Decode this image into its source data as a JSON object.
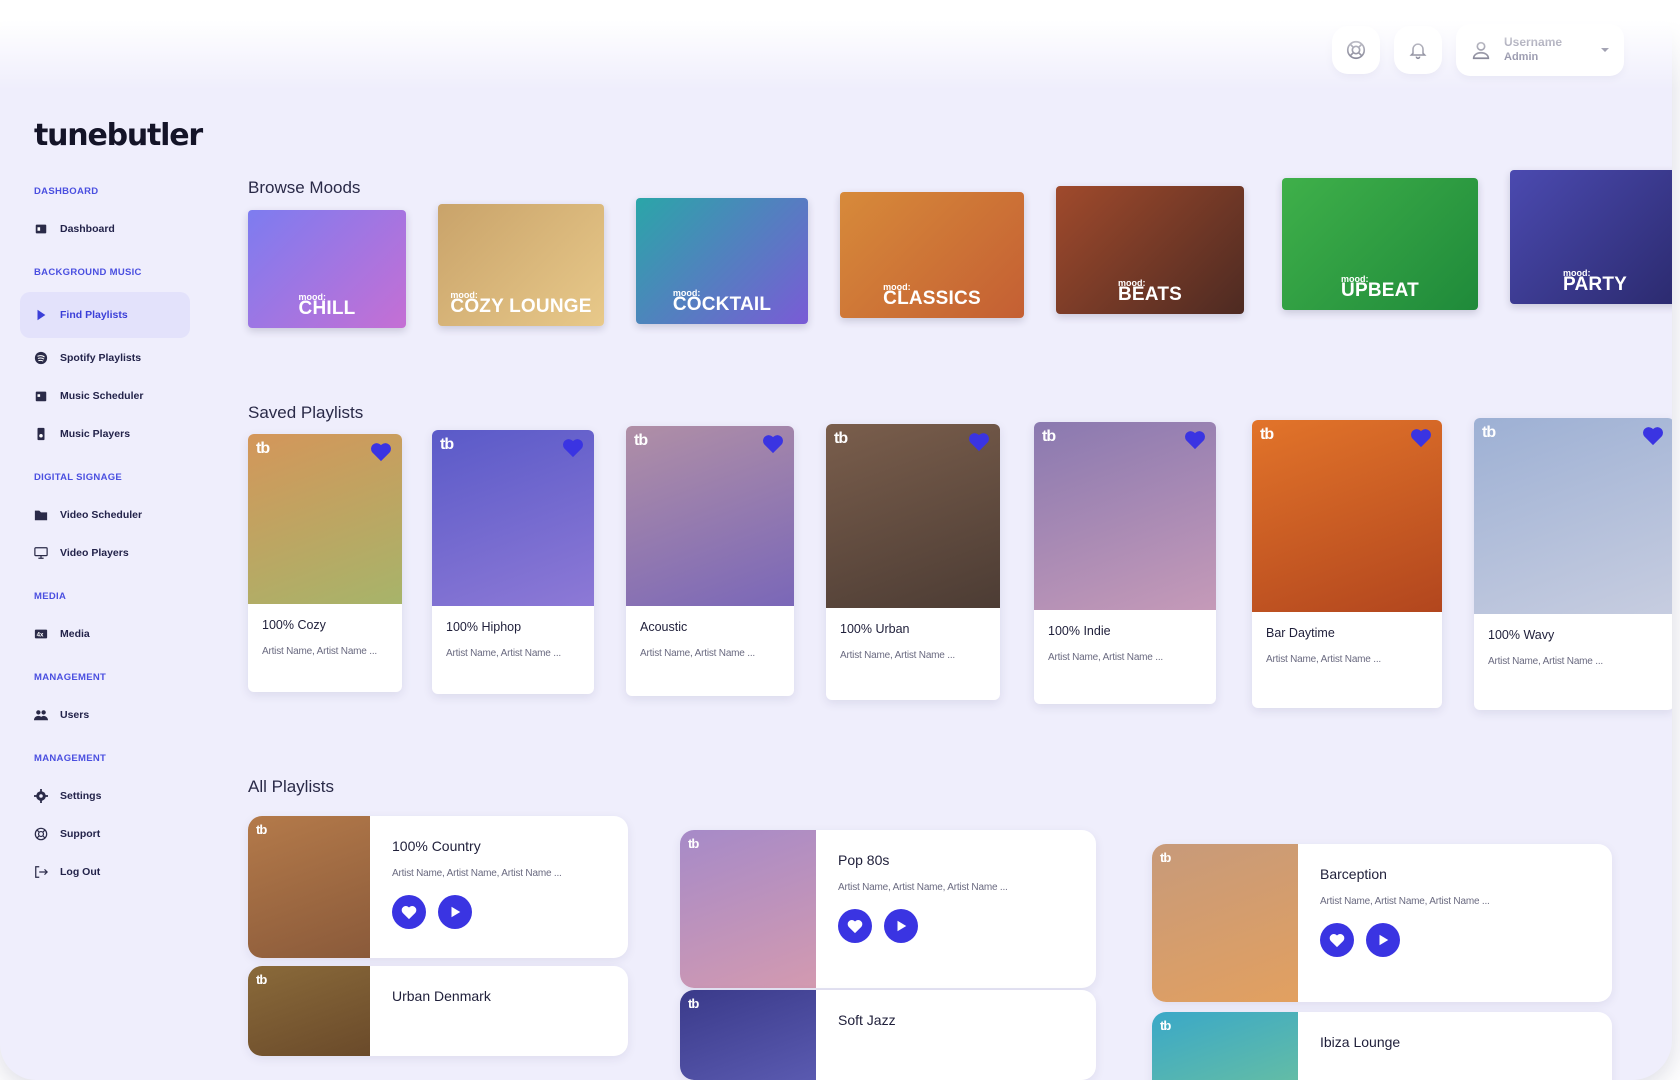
{
  "app": {
    "logo": "tunebutler"
  },
  "header": {
    "username": "Username",
    "role": "Admin"
  },
  "sidebar": {
    "sections": [
      {
        "title": "DASHBOARD",
        "items": [
          {
            "label": "Dashboard",
            "icon": "dashboard-icon"
          }
        ]
      },
      {
        "title": "BACKGROUND MUSIC",
        "items": [
          {
            "label": "Find Playlists",
            "icon": "play-icon",
            "active": true
          },
          {
            "label": "Spotify Playlists",
            "icon": "spotify-icon"
          },
          {
            "label": "Music Scheduler",
            "icon": "calendar-icon"
          },
          {
            "label": "Music Players",
            "icon": "speaker-icon"
          }
        ]
      },
      {
        "title": "DIGITAL SIGNAGE",
        "items": [
          {
            "label": "Video Scheduler",
            "icon": "folder-icon"
          },
          {
            "label": "Video Players",
            "icon": "monitor-icon"
          }
        ]
      },
      {
        "title": "MEDIA",
        "items": [
          {
            "label": "Media",
            "icon": "media-icon"
          }
        ]
      },
      {
        "title": "MANAGEMENT",
        "items": [
          {
            "label": "Users",
            "icon": "users-icon"
          }
        ]
      },
      {
        "title": "MANAGEMENT",
        "items": [
          {
            "label": "Settings",
            "icon": "gear-icon"
          },
          {
            "label": "Support",
            "icon": "support-icon"
          },
          {
            "label": "Log Out",
            "icon": "logout-icon"
          }
        ]
      }
    ]
  },
  "browse": {
    "title": "Browse Moods",
    "moods": [
      {
        "small": "mood:",
        "big": "CHILL",
        "color": "#7d7cf0",
        "color2": "#c56fd4"
      },
      {
        "small": "mood:",
        "big": "COZY LOUNGE",
        "color": "#c9a36a",
        "color2": "#e8c98a"
      },
      {
        "small": "mood:",
        "big": "COCKTAIL",
        "color": "#2aa6a8",
        "color2": "#7a5bd6"
      },
      {
        "small": "mood:",
        "big": "CLASSICS",
        "color": "#d78a3a",
        "color2": "#c45f33"
      },
      {
        "small": "mood:",
        "big": "BEATS",
        "color": "#a04a2c",
        "color2": "#4d2a22"
      },
      {
        "small": "mood:",
        "big": "UPBEAT",
        "color": "#3fb04a",
        "color2": "#1f8a3a"
      },
      {
        "small": "mood:",
        "big": "PARTY",
        "color": "#4b4ab0",
        "color2": "#2b2a6e"
      }
    ]
  },
  "saved": {
    "title": "Saved Playlists",
    "items": [
      {
        "name": "100% Cozy",
        "artists": "Artist Name, Artist Name ...",
        "badge": "tb",
        "color": "#d4965a",
        "color2": "#a7b46a"
      },
      {
        "name": "100% Hiphop",
        "artists": "Artist Name, Artist Name ...",
        "badge": "tb",
        "color": "#5a5ac8",
        "color2": "#8d79d6"
      },
      {
        "name": "Acoustic",
        "artists": "Artist Name, Artist Name ...",
        "badge": "tb",
        "color": "#b08fa6",
        "color2": "#7a67b8"
      },
      {
        "name": "100% Urban",
        "artists": "Artist Name, Artist Name ...",
        "badge": "tb",
        "color": "#7a5e4c",
        "color2": "#4c3c34"
      },
      {
        "name": "100% Indie",
        "artists": "Artist Name, Artist Name ...",
        "badge": "tb",
        "color": "#8a79b0",
        "color2": "#c59ab8"
      },
      {
        "name": "Bar Daytime",
        "artists": "Artist Name, Artist Name ...",
        "badge": "tb",
        "color": "#e2742a",
        "color2": "#b2461e"
      },
      {
        "name": "100% Wavy",
        "artists": "Artist Name, Artist Name ...",
        "badge": "tb",
        "color": "#9db0d4",
        "color2": "#c7cde0"
      }
    ]
  },
  "all": {
    "title": "All Playlists",
    "items": [
      {
        "name": "100% Country",
        "artists": "Artist Name, Artist Name, Artist Name ...",
        "badge": "tb",
        "color": "#b47a4a",
        "color2": "#8a5a3a"
      },
      {
        "name": "Pop 80s",
        "artists": "Artist Name, Artist Name, Artist Name ...",
        "badge": "tb",
        "color": "#a68ac8",
        "color2": "#d39ab0"
      },
      {
        "name": "Barception",
        "artists": "Artist Name, Artist Name, Artist Name ...",
        "badge": "tb",
        "color": "#c79a7a",
        "color2": "#e2a060"
      },
      {
        "name": "Urban Denmark",
        "badge": "tb",
        "color": "#8a6a3a",
        "color2": "#6a4a2a"
      },
      {
        "name": "Soft Jazz",
        "badge": "tb",
        "color": "#3a3a8a",
        "color2": "#5a5ab0"
      },
      {
        "name": "Ibiza Lounge",
        "badge": "tb",
        "color": "#3aa8c8",
        "color2": "#6ac0a0"
      }
    ]
  },
  "colors": {
    "accent": "#3a34e2",
    "background": "#efeefc"
  }
}
